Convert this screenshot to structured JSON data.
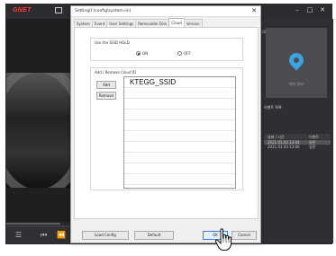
{
  "app": {
    "logo": "GNET",
    "window_controls": [
      "–",
      "□",
      "✕"
    ],
    "gps_label": "GPS",
    "map_label": "위치 정보",
    "events_title": "이벤트 목록",
    "events_headers": [
      "날짜 / 시간",
      "이벤트"
    ],
    "events": [
      {
        "time": "2021.01.03 13:04",
        "type": "일반",
        "selected": true
      },
      {
        "time": "2021.01.03 13:06",
        "type": "일반",
        "selected": false
      }
    ],
    "play_controls": [
      "☰",
      "⏮",
      "⏪"
    ]
  },
  "dialog": {
    "title": "Setting(I:\\config\\system.ini)",
    "close_glyph": "✕",
    "tabs": [
      {
        "label": "System",
        "active": false
      },
      {
        "label": "Event",
        "active": false
      },
      {
        "label": "User Settings",
        "active": false
      },
      {
        "label": "Removable Disk",
        "active": false
      },
      {
        "label": "Cloud",
        "active": true
      },
      {
        "label": "Version",
        "active": false
      }
    ],
    "ssid_group": {
      "label": "Use the SSID HOLD",
      "options": [
        {
          "label": "ON",
          "checked": true
        },
        {
          "label": "OFF",
          "checked": false
        }
      ]
    },
    "list_group": {
      "label": "Add / Remove Cloud ID",
      "add_label": "Add",
      "remove_label": "Remove",
      "items": [
        "KTEGG_SSID",
        "",
        "",
        "",
        "",
        "",
        "",
        "",
        "",
        ""
      ]
    },
    "footer": {
      "load_config": "Load Config",
      "default": "Default",
      "ok": "OK",
      "cancel": "Cancel"
    }
  },
  "colors": {
    "app_bg": "#3c3d40",
    "logo": "#ee4444",
    "map_pin": "#3aa3e0",
    "ok_border": "#3b7fd6"
  }
}
